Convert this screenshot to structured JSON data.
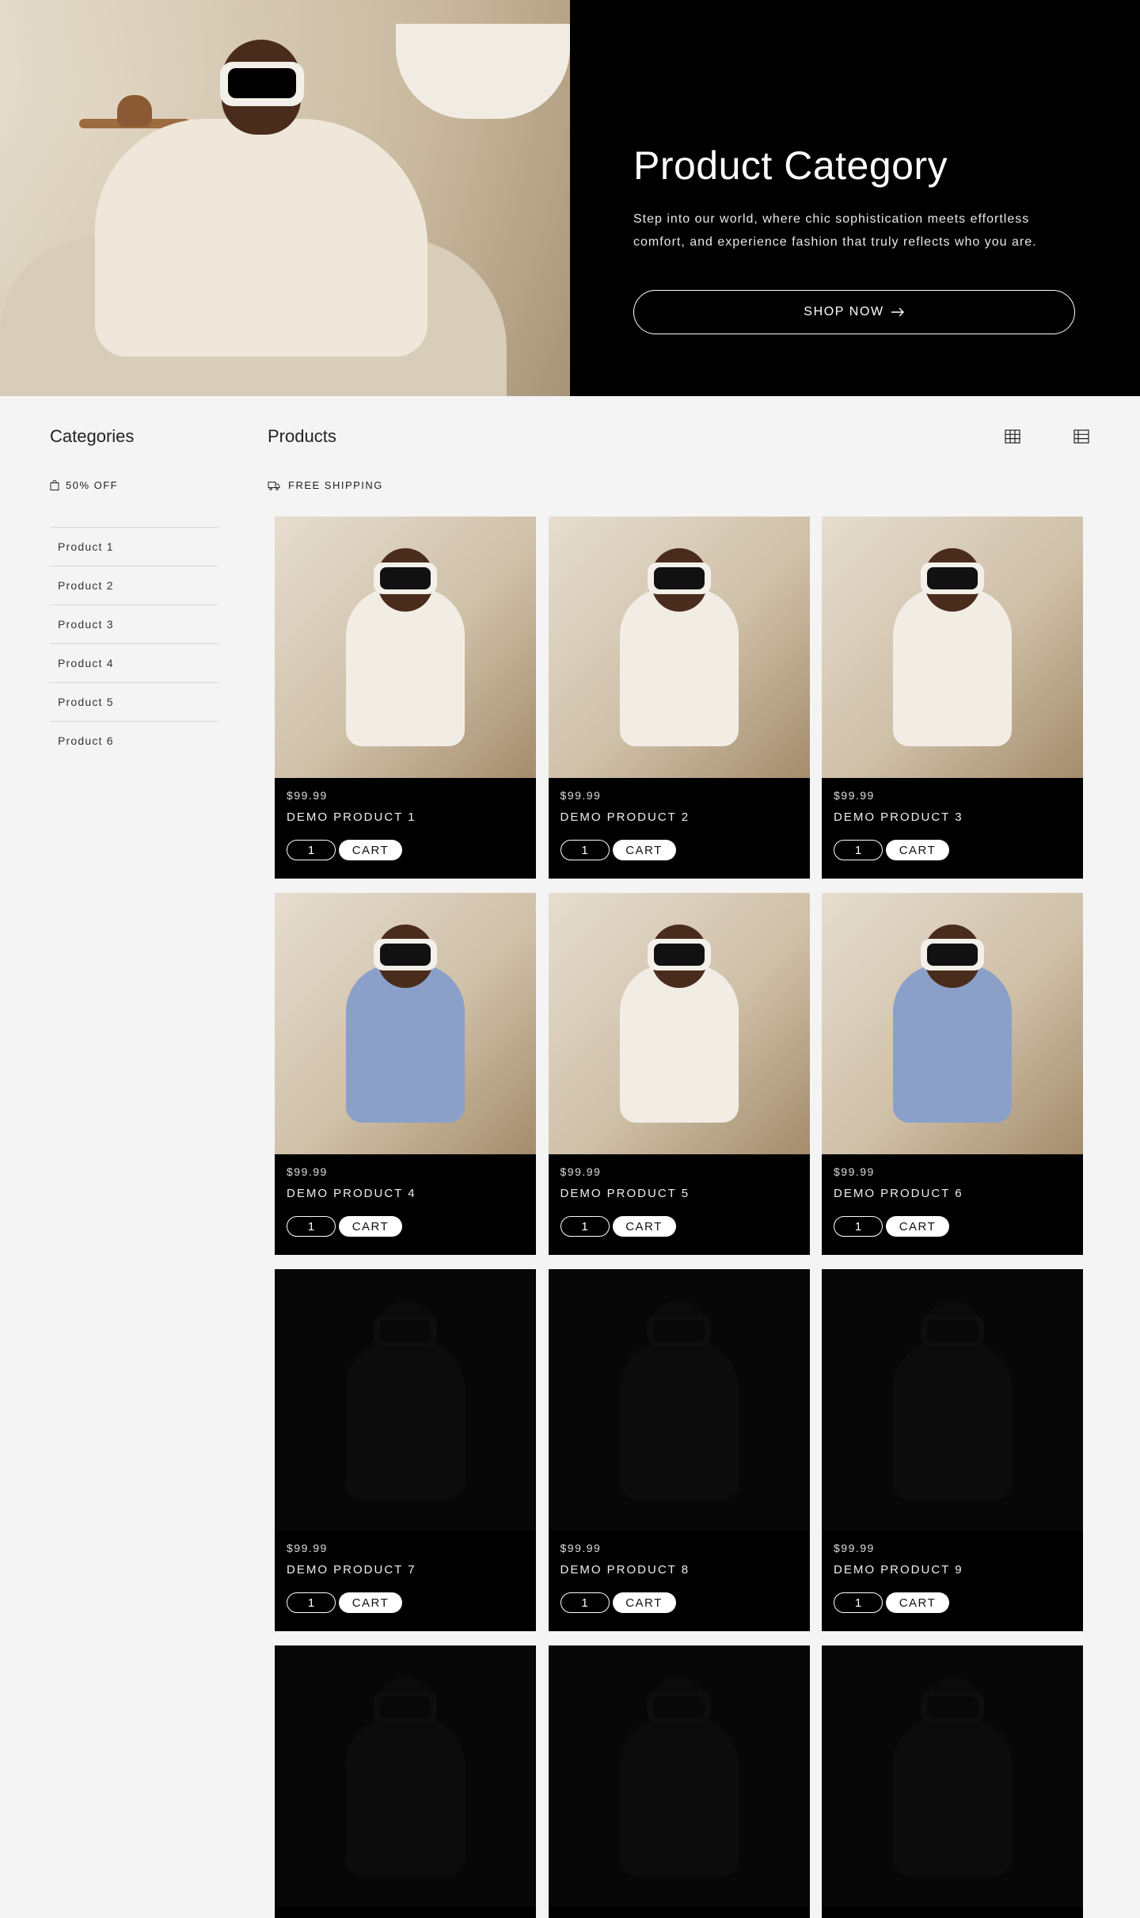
{
  "hero": {
    "title": "Product Category",
    "description": "Step into our world, where chic sophistication meets effortless comfort, and experience fashion that truly reflects who you are.",
    "button_label": "SHOP NOW"
  },
  "sidebar": {
    "title": "Categories",
    "promo": "50% OFF",
    "items": [
      {
        "label": "Product 1"
      },
      {
        "label": "Product 2"
      },
      {
        "label": "Product 3"
      },
      {
        "label": "Product 4"
      },
      {
        "label": "Product 5"
      },
      {
        "label": "Product 6"
      }
    ]
  },
  "products": {
    "title": "Products",
    "shipping": "FREE SHIPPING",
    "items": [
      {
        "price": "$99.99",
        "name": "DEMO PRODUCT 1",
        "qty": "1",
        "cart": "CART"
      },
      {
        "price": "$99.99",
        "name": "DEMO PRODUCT 2",
        "qty": "1",
        "cart": "CART"
      },
      {
        "price": "$99.99",
        "name": "DEMO PRODUCT 3",
        "qty": "1",
        "cart": "CART"
      },
      {
        "price": "$99.99",
        "name": "DEMO PRODUCT 4",
        "qty": "1",
        "cart": "CART"
      },
      {
        "price": "$99.99",
        "name": "DEMO PRODUCT 5",
        "qty": "1",
        "cart": "CART"
      },
      {
        "price": "$99.99",
        "name": "DEMO PRODUCT 6",
        "qty": "1",
        "cart": "CART"
      },
      {
        "price": "$99.99",
        "name": "DEMO PRODUCT 7",
        "qty": "1",
        "cart": "CART"
      },
      {
        "price": "$99.99",
        "name": "DEMO PRODUCT 8",
        "qty": "1",
        "cart": "CART"
      },
      {
        "price": "$99.99",
        "name": "DEMO PRODUCT 9",
        "qty": "1",
        "cart": "CART"
      },
      {
        "price": "",
        "name": "",
        "qty": "",
        "cart": ""
      },
      {
        "price": "",
        "name": "",
        "qty": "",
        "cart": ""
      },
      {
        "price": "",
        "name": "",
        "qty": "",
        "cart": ""
      }
    ]
  },
  "icons": {
    "hero_button": "arrow-right-icon",
    "promo": "shopping-bag-icon",
    "shipping": "truck-icon",
    "view_grid": "grid-view-icon",
    "view_list": "list-view-icon"
  },
  "colors": {
    "page_bg": "#f4f4f4",
    "hero_bg": "#000000",
    "card_bg": "#000000",
    "text_light": "#ffffff"
  }
}
